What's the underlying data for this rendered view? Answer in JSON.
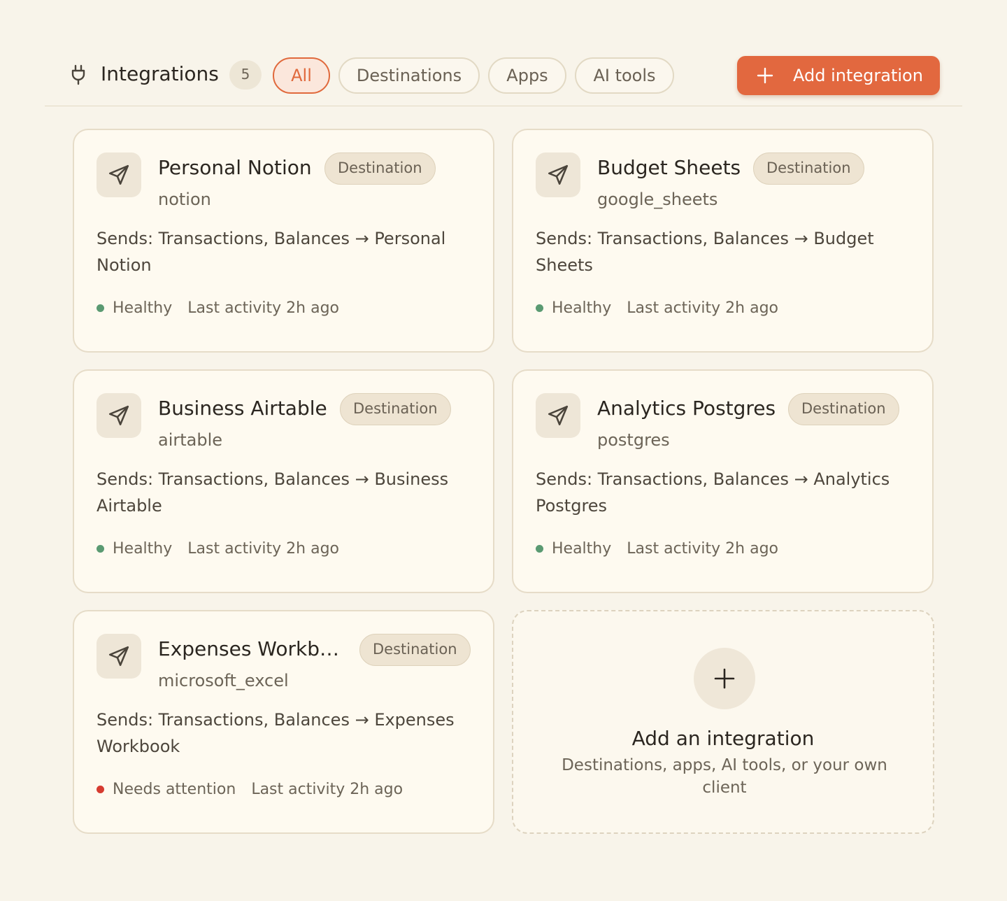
{
  "header": {
    "title": "Integrations",
    "count": "5",
    "filters": [
      {
        "label": "All",
        "active": true
      },
      {
        "label": "Destinations",
        "active": false
      },
      {
        "label": "Apps",
        "active": false
      },
      {
        "label": "AI tools",
        "active": false
      }
    ],
    "add_button_label": "Add integration"
  },
  "cards": [
    {
      "name": "Personal Notion",
      "tag": "Destination",
      "provider": "notion",
      "sends": "Sends: Transactions, Balances → Personal Notion",
      "status": "Healthy",
      "last_activity": "Last activity 2h ago",
      "icon": "send-icon"
    },
    {
      "name": "Budget Sheets",
      "tag": "Destination",
      "provider": "google_sheets",
      "sends": "Sends: Transactions, Balances → Budget Sheets",
      "status": "Healthy",
      "last_activity": "Last activity 2h ago",
      "icon": "send-icon"
    },
    {
      "name": "Business Airtable",
      "tag": "Destination",
      "provider": "airtable",
      "sends": "Sends: Transactions, Balances → Business Airtable",
      "status": "Healthy",
      "last_activity": "Last activity 2h ago",
      "icon": "send-icon"
    },
    {
      "name": "Analytics Postgres",
      "tag": "Destination",
      "provider": "postgres",
      "sends": "Sends: Transactions, Balances → Analytics Postgres",
      "status": "Healthy",
      "last_activity": "Last activity 2h ago",
      "icon": "send-icon"
    },
    {
      "name": "Expenses Workb…",
      "tag": "Destination",
      "provider": "microsoft_excel",
      "sends": "Sends: Transactions, Balances → Expenses Workbook",
      "status": "Needs attention",
      "last_activity": "Last activity 2h ago",
      "icon": "send-icon"
    }
  ],
  "add_card": {
    "title": "Add an integration",
    "description": "Destinations, apps, AI tools, or your own client"
  },
  "colors": {
    "accent": "#e2683f",
    "healthy": "#5a9a72",
    "attention": "#d63b30",
    "background": "#f8f4ea"
  }
}
